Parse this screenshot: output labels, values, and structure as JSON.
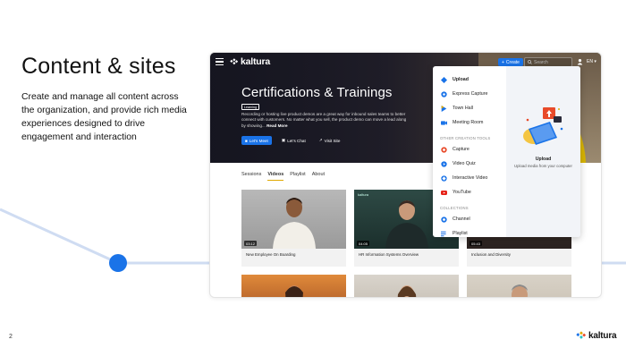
{
  "slide": {
    "title": "Content & sites",
    "description": "Create and manage all content across the organization, and provide rich media experiences designed to drive engagement and interaction",
    "page_number": "2",
    "footer_logo": "kaltura",
    "accent_color": "#1a73e8"
  },
  "app": {
    "brand": "kaltura",
    "create_label": "Create",
    "search_placeholder": "Search",
    "language": "EN",
    "hero": {
      "title": "Certifications & Trainings",
      "badge": "Learning",
      "description": "Recording or hosting live product demos are a great way for inbound sales teams to better connect with customers. No matter what you sell, the product demo can move a lead along by showing...",
      "read_more": "Read More",
      "actions": [
        "Let's Meet",
        "Let's Chat",
        "Visit Site"
      ]
    },
    "tabs": [
      "Sessions",
      "Videos",
      "Playlist",
      "About"
    ],
    "active_tab": "Videos",
    "cards": [
      {
        "title": "New Employee On Boarding",
        "duration": "03:12"
      },
      {
        "title": "HR Information Systems Overview",
        "duration": "04:05"
      },
      {
        "title": "Inclusion and Diversity",
        "duration": "05:43"
      },
      {
        "title": "",
        "duration": ""
      },
      {
        "title": "",
        "duration": ""
      },
      {
        "title": "",
        "duration": ""
      }
    ],
    "card_logo_text": "kaltura"
  },
  "dropdown": {
    "primary_items": [
      {
        "label": "Upload",
        "icon": "upload-icon"
      },
      {
        "label": "Express Capture",
        "icon": "express-capture-icon"
      },
      {
        "label": "Town Hall",
        "icon": "town-hall-icon"
      },
      {
        "label": "Meeting Room",
        "icon": "meeting-room-icon"
      }
    ],
    "other_section": "OTHER CREATION TOOLS",
    "other_items": [
      {
        "label": "Capture",
        "icon": "capture-icon"
      },
      {
        "label": "Video Quiz",
        "icon": "video-quiz-icon"
      },
      {
        "label": "Interactive Video",
        "icon": "interactive-video-icon"
      },
      {
        "label": "YouTube",
        "icon": "youtube-icon"
      }
    ],
    "collections_section": "COLLECTIONS",
    "collection_items": [
      {
        "label": "Channel",
        "icon": "channel-icon"
      },
      {
        "label": "Playlist",
        "icon": "playlist-icon"
      }
    ],
    "panel_title": "Upload",
    "panel_subtitle": "Upload media from your computer"
  }
}
